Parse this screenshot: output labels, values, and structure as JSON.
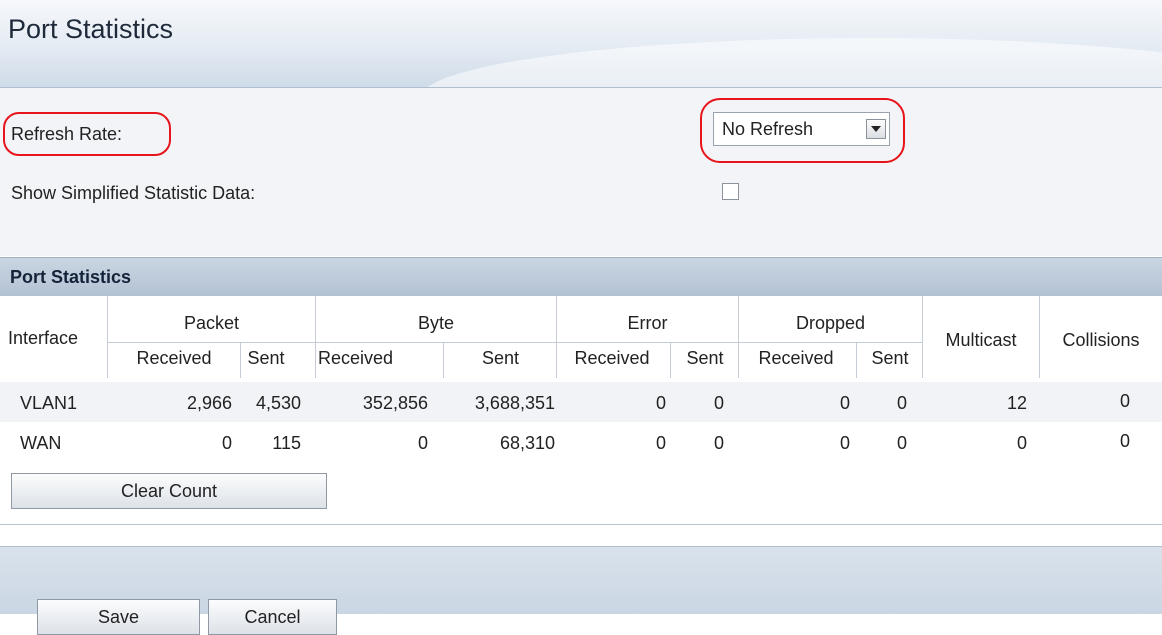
{
  "page": {
    "title": "Port Statistics"
  },
  "settings": {
    "refresh_label": "Refresh Rate:",
    "refresh_value": "No Refresh",
    "simplified_label": "Show Simplified Statistic Data:",
    "simplified_checked": false
  },
  "table": {
    "section_title": "Port Statistics",
    "col_interface": "Interface",
    "groups": {
      "packet": "Packet",
      "byte": "Byte",
      "error": "Error",
      "dropped": "Dropped"
    },
    "sub": {
      "received": "Received",
      "sent": "Sent"
    },
    "col_multicast": "Multicast",
    "col_collisions": "Collisions",
    "rows": [
      {
        "interface": "VLAN1",
        "packet_received": "2,966",
        "packet_sent": "4,530",
        "byte_received": "352,856",
        "byte_sent": "3,688,351",
        "error_received": "0",
        "error_sent": "0",
        "dropped_received": "0",
        "dropped_sent": "0",
        "multicast": "12",
        "collisions": "0"
      },
      {
        "interface": "WAN",
        "packet_received": "0",
        "packet_sent": "115",
        "byte_received": "0",
        "byte_sent": "68,310",
        "error_received": "0",
        "error_sent": "0",
        "dropped_received": "0",
        "dropped_sent": "0",
        "multicast": "0",
        "collisions": "0"
      }
    ],
    "clear_label": "Clear Count"
  },
  "footer": {
    "save_label": "Save",
    "cancel_label": "Cancel"
  },
  "colors": {
    "highlight": "#e8141b",
    "section_bar": "#bccad9"
  }
}
